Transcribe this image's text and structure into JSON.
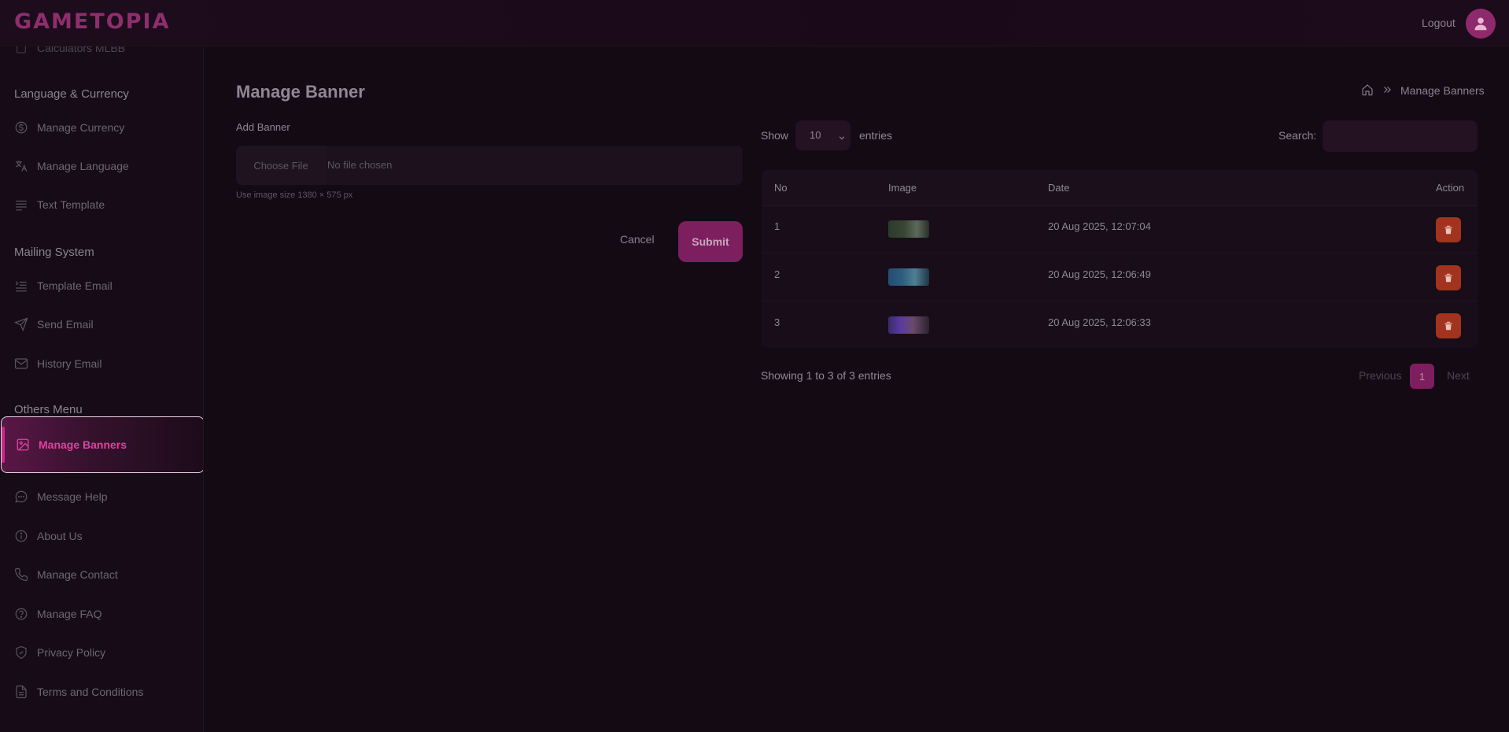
{
  "app": {
    "logo": "GAMETOPIA",
    "logout_label": "Logout"
  },
  "sidebar": {
    "partial_item": "Calculators MLBB",
    "sections": [
      {
        "heading": "Language & Currency",
        "items": [
          {
            "label": "Manage Currency",
            "icon": "currency-icon"
          },
          {
            "label": "Manage Language",
            "icon": "translate-icon"
          },
          {
            "label": "Text Template",
            "icon": "text-lines-icon"
          }
        ]
      },
      {
        "heading": "Mailing System",
        "items": [
          {
            "label": "Template Email",
            "icon": "list-indent-icon"
          },
          {
            "label": "Send Email",
            "icon": "send-icon"
          },
          {
            "label": "History Email",
            "icon": "mail-icon"
          }
        ]
      },
      {
        "heading": "Others Menu",
        "items": [
          {
            "label": "Manage Banners",
            "icon": "image-icon",
            "active": true
          },
          {
            "label": "Message Help",
            "icon": "chat-icon"
          },
          {
            "label": "About Us",
            "icon": "info-icon"
          },
          {
            "label": "Manage Contact",
            "icon": "phone-icon"
          },
          {
            "label": "Manage FAQ",
            "icon": "question-icon"
          },
          {
            "label": "Privacy Policy",
            "icon": "shield-check-icon"
          },
          {
            "label": "Terms and Conditions",
            "icon": "document-icon"
          }
        ]
      }
    ]
  },
  "page": {
    "title": "Manage Banner",
    "breadcrumb": {
      "current": "Manage Banners"
    }
  },
  "form": {
    "label": "Add Banner",
    "file_button": "Choose File",
    "file_status": "No file chosen",
    "hint": "Use image size 1380 × 575 px",
    "cancel_label": "Cancel",
    "submit_label": "Submit"
  },
  "table": {
    "show_label": "Show",
    "entries_value": "10",
    "entries_label": "entries",
    "search_label": "Search:",
    "search_value": "",
    "columns": [
      "No",
      "Image",
      "Date",
      "Action"
    ],
    "rows": [
      {
        "no": "1",
        "date": "20 Aug 2025, 12:07:04"
      },
      {
        "no": "2",
        "date": "20 Aug 2025, 12:06:49"
      },
      {
        "no": "3",
        "date": "20 Aug 2025, 12:06:33"
      }
    ],
    "footer": "Showing 1 to 3 of 3 entries",
    "pagination": {
      "previous": "Previous",
      "page": "1",
      "next": "Next"
    }
  },
  "colors": {
    "accent": "#7d1f5e",
    "active_text": "#e2419d",
    "delete": "#a2331f"
  }
}
